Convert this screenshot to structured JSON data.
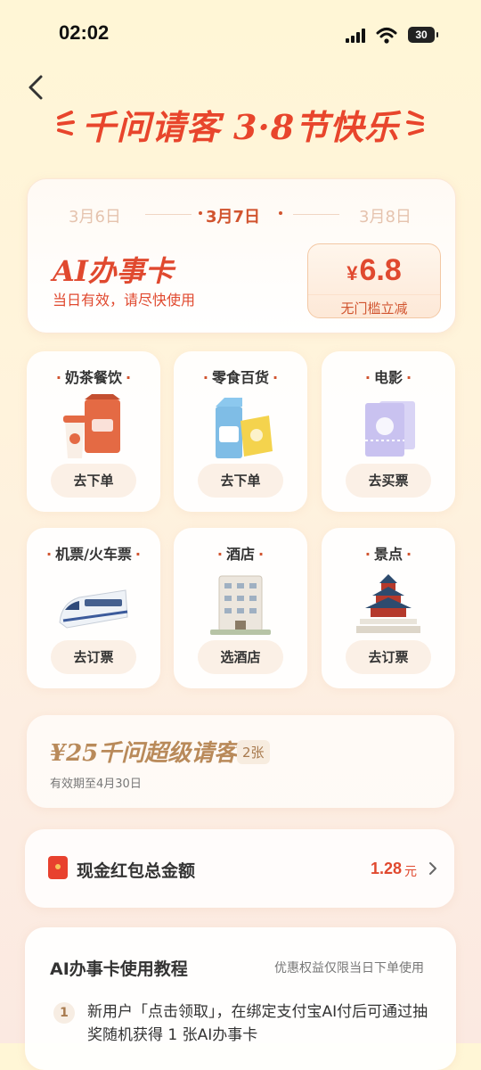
{
  "status_bar": {
    "time": "02:02",
    "battery": "30"
  },
  "header": {
    "title": "千问请客 3·8节快乐"
  },
  "ai_card": {
    "dates": [
      "3月6日",
      "3月7日",
      "3月8日"
    ],
    "title": "AI办事卡",
    "subtitle": "当日有效，请尽快使用",
    "discount_currency": "¥",
    "discount_value": "6.8",
    "discount_label": "无门槛立减"
  },
  "categories": [
    {
      "label": "奶茶餐饮",
      "button": "去下单",
      "icon": "milk-tea-icon"
    },
    {
      "label": "零食百货",
      "button": "去下单",
      "icon": "snacks-icon"
    },
    {
      "label": "电影",
      "button": "去买票",
      "icon": "movie-ticket-icon"
    },
    {
      "label": "机票/火车票",
      "button": "去订票",
      "icon": "train-icon"
    },
    {
      "label": "酒店",
      "button": "选酒店",
      "icon": "hotel-icon"
    },
    {
      "label": "景点",
      "button": "去订票",
      "icon": "temple-icon"
    }
  ],
  "super_card": {
    "title": "¥25千问超级请客卡",
    "count": "2张",
    "validity": "有效期至4月30日"
  },
  "red_packet": {
    "label": "现金红包总金额",
    "amount": "1.28",
    "unit": "元"
  },
  "tutorial": {
    "title": "AI办事卡使用教程",
    "note": "优惠权益仅限当日下单使用",
    "step_number": "1",
    "step_text": "新用户「点击领取」，在绑定支付宝AI付后可通过抽奖随机获得 1 张AI办事卡"
  },
  "colors": {
    "accent": "#e0492f",
    "gold": "#b98a5a"
  }
}
